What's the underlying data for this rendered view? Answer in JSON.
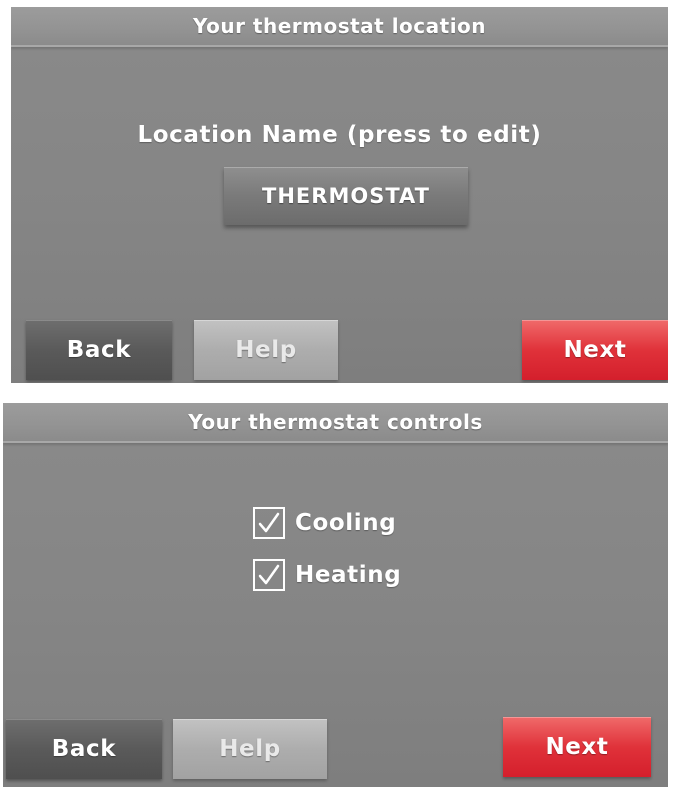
{
  "screen_location": {
    "title": "Your thermostat location",
    "field_label": "Location Name (press to edit)",
    "location_value": "THERMOSTAT",
    "buttons": {
      "back": "Back",
      "help": "Help",
      "next": "Next"
    }
  },
  "screen_controls": {
    "title": "Your thermostat controls",
    "options": [
      {
        "label": "Cooling",
        "checked": true,
        "icon": "checkmark-icon"
      },
      {
        "label": "Heating",
        "checked": true,
        "icon": "checkmark-icon"
      }
    ],
    "buttons": {
      "back": "Back",
      "help": "Help",
      "next": "Next"
    }
  },
  "colors": {
    "screen_bg": "#858585",
    "next_accent": "#e0323a",
    "text": "#ffffff"
  }
}
